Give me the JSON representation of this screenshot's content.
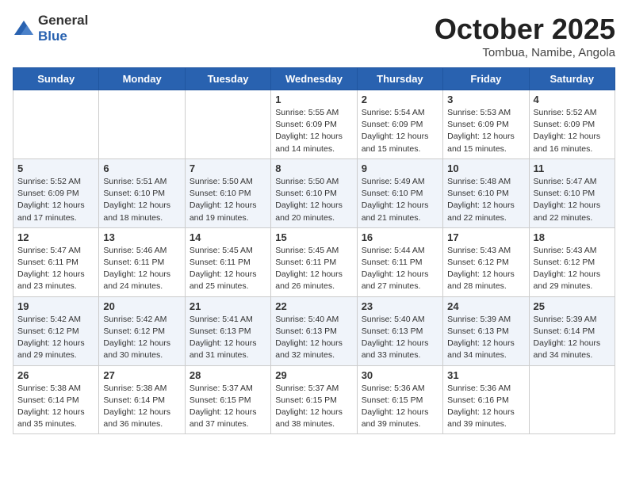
{
  "logo": {
    "general": "General",
    "blue": "Blue"
  },
  "header": {
    "month": "October 2025",
    "location": "Tombua, Namibe, Angola"
  },
  "weekdays": [
    "Sunday",
    "Monday",
    "Tuesday",
    "Wednesday",
    "Thursday",
    "Friday",
    "Saturday"
  ],
  "weeks": [
    [
      {
        "day": "",
        "info": ""
      },
      {
        "day": "",
        "info": ""
      },
      {
        "day": "",
        "info": ""
      },
      {
        "day": "1",
        "info": "Sunrise: 5:55 AM\nSunset: 6:09 PM\nDaylight: 12 hours\nand 14 minutes."
      },
      {
        "day": "2",
        "info": "Sunrise: 5:54 AM\nSunset: 6:09 PM\nDaylight: 12 hours\nand 15 minutes."
      },
      {
        "day": "3",
        "info": "Sunrise: 5:53 AM\nSunset: 6:09 PM\nDaylight: 12 hours\nand 15 minutes."
      },
      {
        "day": "4",
        "info": "Sunrise: 5:52 AM\nSunset: 6:09 PM\nDaylight: 12 hours\nand 16 minutes."
      }
    ],
    [
      {
        "day": "5",
        "info": "Sunrise: 5:52 AM\nSunset: 6:09 PM\nDaylight: 12 hours\nand 17 minutes."
      },
      {
        "day": "6",
        "info": "Sunrise: 5:51 AM\nSunset: 6:10 PM\nDaylight: 12 hours\nand 18 minutes."
      },
      {
        "day": "7",
        "info": "Sunrise: 5:50 AM\nSunset: 6:10 PM\nDaylight: 12 hours\nand 19 minutes."
      },
      {
        "day": "8",
        "info": "Sunrise: 5:50 AM\nSunset: 6:10 PM\nDaylight: 12 hours\nand 20 minutes."
      },
      {
        "day": "9",
        "info": "Sunrise: 5:49 AM\nSunset: 6:10 PM\nDaylight: 12 hours\nand 21 minutes."
      },
      {
        "day": "10",
        "info": "Sunrise: 5:48 AM\nSunset: 6:10 PM\nDaylight: 12 hours\nand 22 minutes."
      },
      {
        "day": "11",
        "info": "Sunrise: 5:47 AM\nSunset: 6:10 PM\nDaylight: 12 hours\nand 22 minutes."
      }
    ],
    [
      {
        "day": "12",
        "info": "Sunrise: 5:47 AM\nSunset: 6:11 PM\nDaylight: 12 hours\nand 23 minutes."
      },
      {
        "day": "13",
        "info": "Sunrise: 5:46 AM\nSunset: 6:11 PM\nDaylight: 12 hours\nand 24 minutes."
      },
      {
        "day": "14",
        "info": "Sunrise: 5:45 AM\nSunset: 6:11 PM\nDaylight: 12 hours\nand 25 minutes."
      },
      {
        "day": "15",
        "info": "Sunrise: 5:45 AM\nSunset: 6:11 PM\nDaylight: 12 hours\nand 26 minutes."
      },
      {
        "day": "16",
        "info": "Sunrise: 5:44 AM\nSunset: 6:11 PM\nDaylight: 12 hours\nand 27 minutes."
      },
      {
        "day": "17",
        "info": "Sunrise: 5:43 AM\nSunset: 6:12 PM\nDaylight: 12 hours\nand 28 minutes."
      },
      {
        "day": "18",
        "info": "Sunrise: 5:43 AM\nSunset: 6:12 PM\nDaylight: 12 hours\nand 29 minutes."
      }
    ],
    [
      {
        "day": "19",
        "info": "Sunrise: 5:42 AM\nSunset: 6:12 PM\nDaylight: 12 hours\nand 29 minutes."
      },
      {
        "day": "20",
        "info": "Sunrise: 5:42 AM\nSunset: 6:12 PM\nDaylight: 12 hours\nand 30 minutes."
      },
      {
        "day": "21",
        "info": "Sunrise: 5:41 AM\nSunset: 6:13 PM\nDaylight: 12 hours\nand 31 minutes."
      },
      {
        "day": "22",
        "info": "Sunrise: 5:40 AM\nSunset: 6:13 PM\nDaylight: 12 hours\nand 32 minutes."
      },
      {
        "day": "23",
        "info": "Sunrise: 5:40 AM\nSunset: 6:13 PM\nDaylight: 12 hours\nand 33 minutes."
      },
      {
        "day": "24",
        "info": "Sunrise: 5:39 AM\nSunset: 6:13 PM\nDaylight: 12 hours\nand 34 minutes."
      },
      {
        "day": "25",
        "info": "Sunrise: 5:39 AM\nSunset: 6:14 PM\nDaylight: 12 hours\nand 34 minutes."
      }
    ],
    [
      {
        "day": "26",
        "info": "Sunrise: 5:38 AM\nSunset: 6:14 PM\nDaylight: 12 hours\nand 35 minutes."
      },
      {
        "day": "27",
        "info": "Sunrise: 5:38 AM\nSunset: 6:14 PM\nDaylight: 12 hours\nand 36 minutes."
      },
      {
        "day": "28",
        "info": "Sunrise: 5:37 AM\nSunset: 6:15 PM\nDaylight: 12 hours\nand 37 minutes."
      },
      {
        "day": "29",
        "info": "Sunrise: 5:37 AM\nSunset: 6:15 PM\nDaylight: 12 hours\nand 38 minutes."
      },
      {
        "day": "30",
        "info": "Sunrise: 5:36 AM\nSunset: 6:15 PM\nDaylight: 12 hours\nand 39 minutes."
      },
      {
        "day": "31",
        "info": "Sunrise: 5:36 AM\nSunset: 6:16 PM\nDaylight: 12 hours\nand 39 minutes."
      },
      {
        "day": "",
        "info": ""
      }
    ]
  ]
}
